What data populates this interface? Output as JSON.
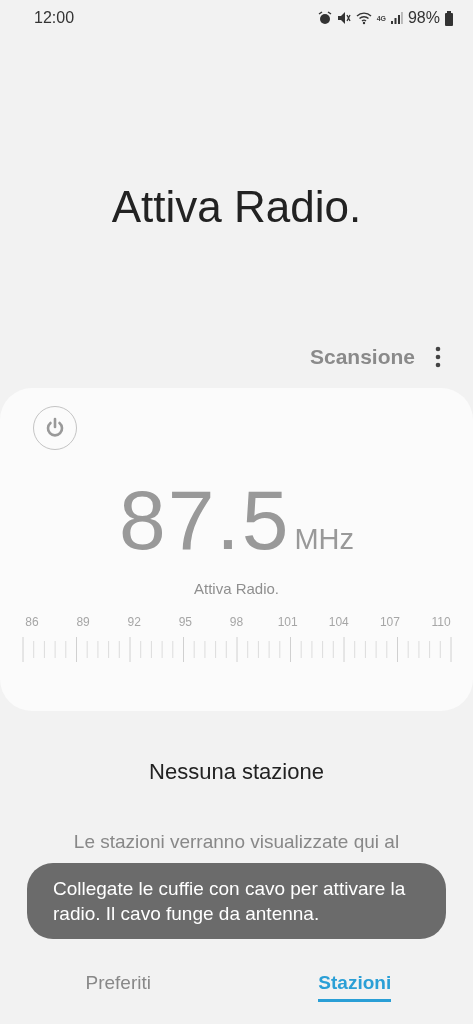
{
  "status_bar": {
    "time": "12:00",
    "network_type": "4G",
    "battery": "98%"
  },
  "title": "Attiva Radio.",
  "toolbar": {
    "scan": "Scansione"
  },
  "tuner": {
    "power_on": false,
    "frequency": "87.5",
    "unit": "MHz",
    "status": "Attiva Radio.",
    "scale_labels": [
      "86",
      "89",
      "92",
      "95",
      "98",
      "101",
      "104",
      "107",
      "110"
    ]
  },
  "stations": {
    "heading": "Nessuna stazione",
    "hint": "Le stazioni verranno visualizzate qui al"
  },
  "toast": {
    "text": "Collegate le cuffie con cavo per attivare la radio. Il cavo funge da antenna."
  },
  "tabs": [
    {
      "label": "Preferiti",
      "selected": false
    },
    {
      "label": "Stazioni",
      "selected": true
    }
  ]
}
